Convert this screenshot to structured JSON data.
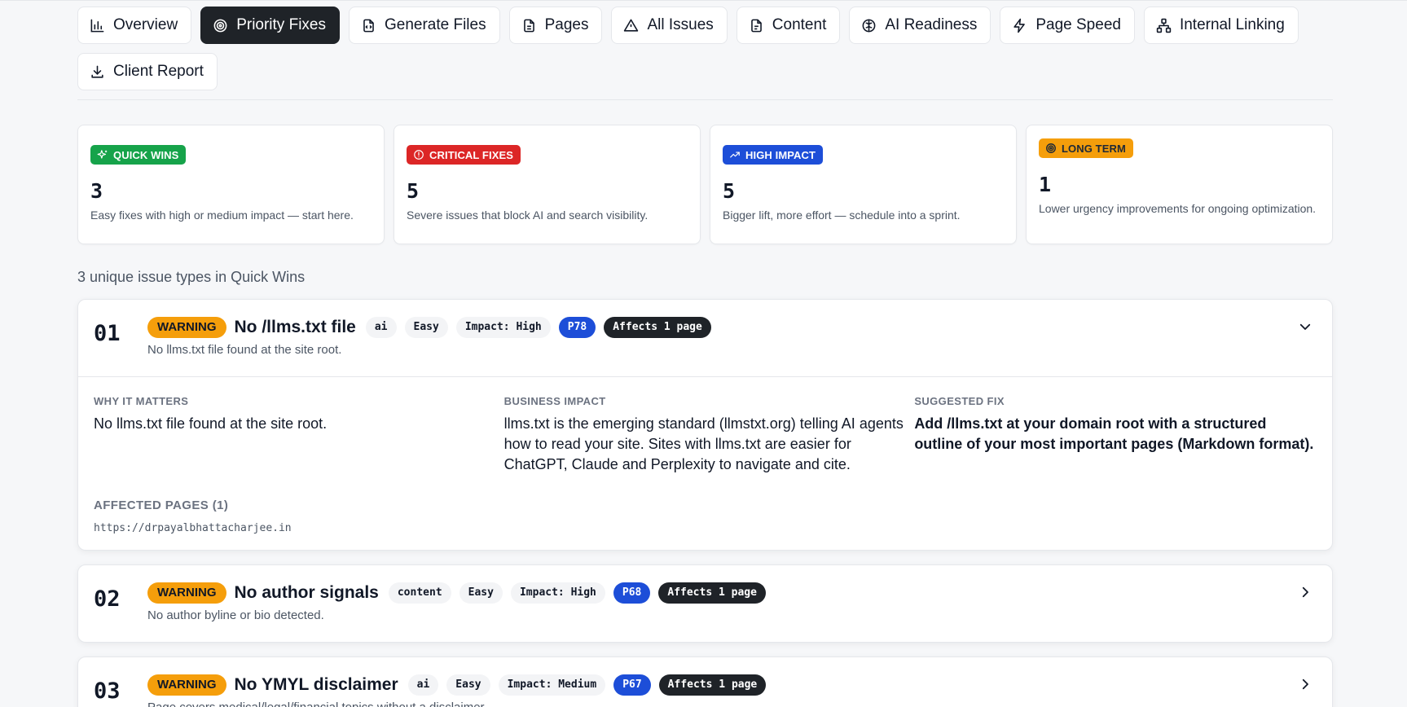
{
  "tabs": [
    {
      "label": "Overview",
      "icon": "bar-chart-icon",
      "active": false
    },
    {
      "label": "Priority Fixes",
      "icon": "target-icon",
      "active": true
    },
    {
      "label": "Generate Files",
      "icon": "file-code-icon",
      "active": false
    },
    {
      "label": "Pages",
      "icon": "file-text-icon",
      "active": false
    },
    {
      "label": "All Issues",
      "icon": "warning-icon",
      "active": false
    },
    {
      "label": "Content",
      "icon": "document-icon",
      "active": false
    },
    {
      "label": "AI Readiness",
      "icon": "brain-icon",
      "active": false
    },
    {
      "label": "Page Speed",
      "icon": "lightning-icon",
      "active": false
    },
    {
      "label": "Internal Linking",
      "icon": "network-icon",
      "active": false
    },
    {
      "label": "Client Report",
      "icon": "download-icon",
      "active": false
    }
  ],
  "cards": [
    {
      "badge": "QUICK WINS",
      "count": "3",
      "desc": "Easy fixes with high or medium impact — start here.",
      "color": "#16a34a",
      "icon": "sparkles-icon"
    },
    {
      "badge": "CRITICAL FIXES",
      "count": "5",
      "desc": "Severe issues that block AI and search visibility.",
      "color": "#dc2626",
      "icon": "alert-circle-icon"
    },
    {
      "badge": "HIGH IMPACT",
      "count": "5",
      "desc": "Bigger lift, more effort — schedule into a sprint.",
      "color": "#1d4ed8",
      "icon": "trending-up-icon"
    },
    {
      "badge": "LONG TERM",
      "count": "1",
      "desc": "Lower urgency improvements for ongoing optimization.",
      "color": "#f59e0b",
      "icon": "target-icon"
    }
  ],
  "summary": "3 unique issue types in Quick Wins",
  "issues": [
    {
      "num": "01",
      "severity": "WARNING",
      "title": "No /llms.txt file",
      "category": "ai",
      "effort": "Easy",
      "impact": "Impact: High",
      "priority": "P78",
      "affects": "Affects 1 page",
      "subtitle": "No llms.txt file found at the site root.",
      "expanded": true,
      "why_label": "WHY IT MATTERS",
      "why": "No llms.txt file found at the site root.",
      "business_label": "BUSINESS IMPACT",
      "business": "llms.txt is the emerging standard (llmstxt.org) telling AI agents how to read your site. Sites with llms.txt are easier for ChatGPT, Claude and Perplexity to navigate and cite.",
      "fix_label": "SUGGESTED FIX",
      "fix": "Add /llms.txt at your domain root with a structured outline of your most important pages (Markdown format).",
      "affected_label": "AFFECTED PAGES (1)",
      "affected_pages": [
        "https://drpayalbhattacharjee.in"
      ]
    },
    {
      "num": "02",
      "severity": "WARNING",
      "title": "No author signals",
      "category": "content",
      "effort": "Easy",
      "impact": "Impact: High",
      "priority": "P68",
      "affects": "Affects 1 page",
      "subtitle": "No author byline or bio detected.",
      "expanded": false
    },
    {
      "num": "03",
      "severity": "WARNING",
      "title": "No YMYL disclaimer",
      "category": "ai",
      "effort": "Easy",
      "impact": "Impact: Medium",
      "priority": "P67",
      "affects": "Affects 1 page",
      "subtitle": "Page covers medical/legal/financial topics without a disclaimer.",
      "expanded": false
    }
  ]
}
